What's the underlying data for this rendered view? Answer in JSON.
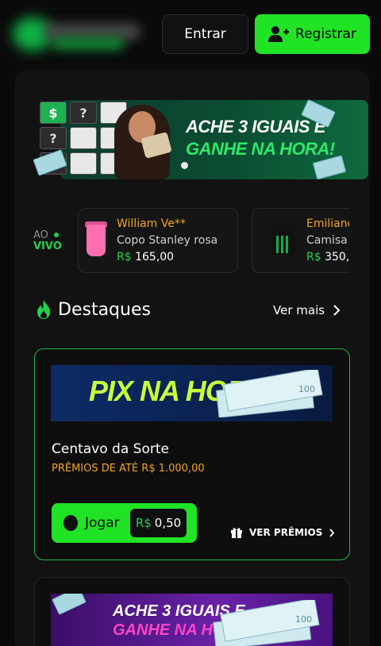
{
  "header": {
    "login_label": "Entrar",
    "register_label": "Registrar"
  },
  "banner": {
    "tile_symbol": "$",
    "tile_unknown": "?",
    "headline_line1": "ACHE 3 IGUAIS E",
    "headline_line2": "GANHE NA HORA!"
  },
  "live": {
    "label_top": "AO",
    "label_bottom": "VIVO",
    "winners": [
      {
        "name": "William Ve**",
        "prize": "Copo Stanley rosa",
        "currency": "R$",
        "amount": "165,00"
      },
      {
        "name": "Emiliano",
        "prize": "Camisa",
        "currency": "R$",
        "amount": "350,"
      }
    ]
  },
  "highlights": {
    "title": "Destaques",
    "see_more": "Ver mais"
  },
  "card": {
    "banner_text": "PIX NA HORA!",
    "title": "Centavo da Sorte",
    "subtitle": "PRÊMIOS DE ATÉ R$ 1.000,00",
    "play_label": "Jogar",
    "price_currency": "R$",
    "price_amount": "0,50",
    "see_prizes": "VER PRÊMIOS"
  },
  "card2": {
    "banner_line1": "ACHE 3 IGUAIS E",
    "banner_line2": "GANHE NA HORA"
  },
  "colors": {
    "accent_green": "#21e326",
    "prize_orange": "#f0a51e",
    "background": "#0a0a0a"
  }
}
